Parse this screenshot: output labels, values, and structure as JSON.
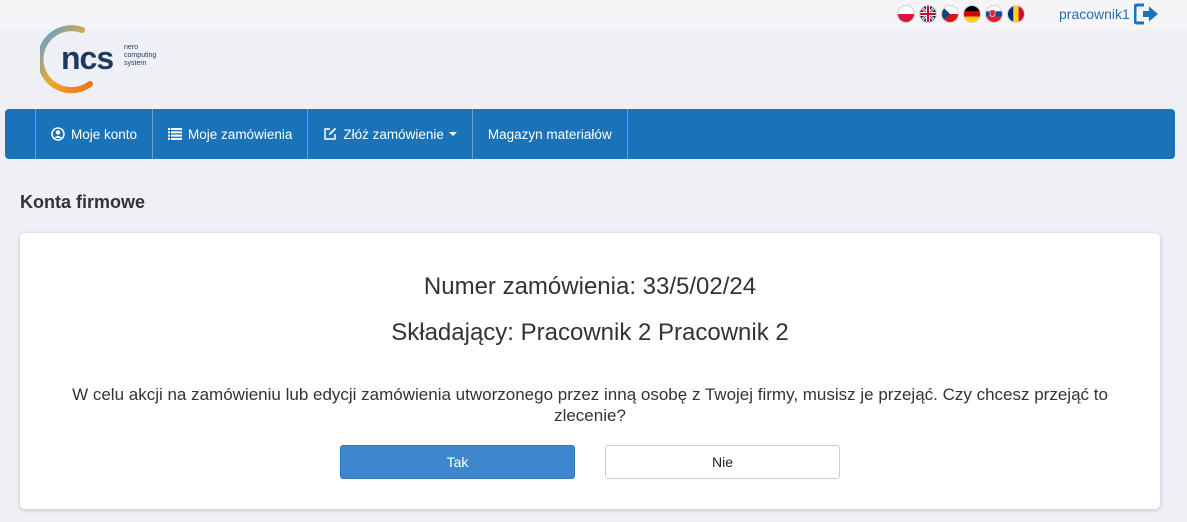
{
  "header": {
    "languages": [
      "pl",
      "en",
      "cs",
      "de",
      "sk",
      "ro"
    ],
    "username": "pracownik1",
    "logout_icon": "sign-out-icon"
  },
  "logo": {
    "text": "ncs",
    "line1": "nero",
    "line2": "computing",
    "line3": "system"
  },
  "nav": {
    "items": [
      {
        "label": "Moje konto",
        "icon": "user-circle-icon"
      },
      {
        "label": "Moje zamówienia",
        "icon": "list-icon"
      },
      {
        "label": "Złóż zamówienie",
        "icon": "edit-icon",
        "dropdown": true
      },
      {
        "label": "Magazyn materiałów"
      }
    ],
    "color": "#1a73b9"
  },
  "page": {
    "title": "Konta firmowe"
  },
  "dialog": {
    "order_number": "Numer zamówienia: 33/5/02/24",
    "submitter": "Składający: Pracownik 2 Pracownik 2",
    "message": "W celu akcji na zamówieniu lub edycji zamówienia utworzonego przez inną osobę z Twojej firmy, musisz je przejąć. Czy chcesz przejąć to zlecenie?",
    "yes_label": "Tak",
    "no_label": "Nie"
  }
}
